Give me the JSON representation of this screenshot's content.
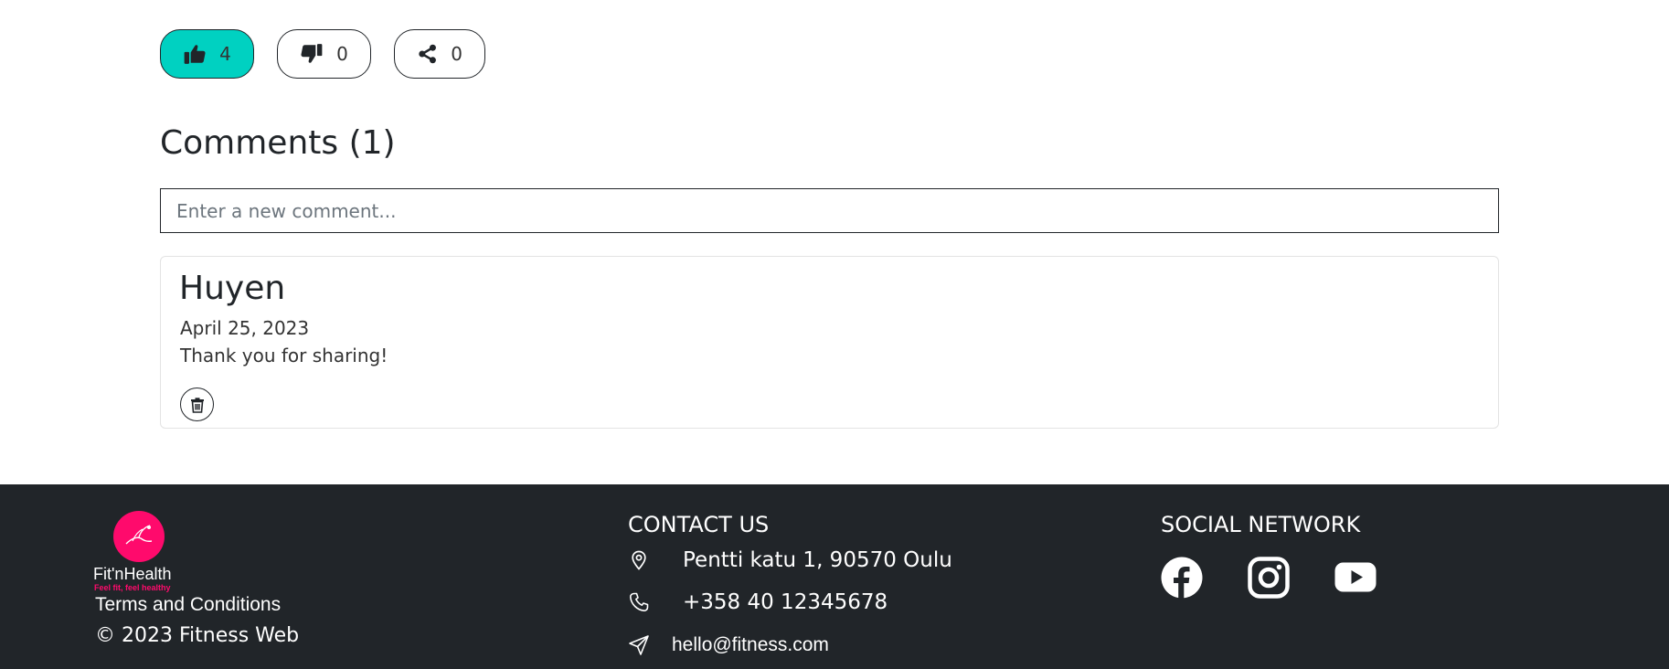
{
  "reactions": {
    "likes": {
      "count": "4",
      "icon": "thumbs-up-icon"
    },
    "dislikes": {
      "count": "0",
      "icon": "thumbs-down-icon"
    },
    "shares": {
      "count": "0",
      "icon": "share-icon"
    },
    "like_active_color": "#00d1c1"
  },
  "comments": {
    "title": "Comments (1)",
    "input_placeholder": "Enter a new comment...",
    "input_value": "",
    "items": [
      {
        "author": "Huyen",
        "date": "April 25, 2023",
        "text": "Thank you for sharing!",
        "delete_icon": "trash-icon"
      }
    ]
  },
  "footer": {
    "background": "#212529",
    "brand": {
      "name": "Fit'nHealth",
      "tagline": "Feel fit, feel healthy",
      "color": "#ff0a6c"
    },
    "terms_label": "Terms and Conditions",
    "copyright": "© 2023 Fitness Web",
    "contact": {
      "title": "CONTACT US",
      "address": "Pentti katu 1, 90570 Oulu",
      "phone": "+358 40 12345678",
      "email": "hello@fitness.com"
    },
    "social": {
      "title": "SOCIAL NETWORK",
      "networks": [
        "facebook-icon",
        "instagram-icon",
        "youtube-icon"
      ]
    }
  }
}
